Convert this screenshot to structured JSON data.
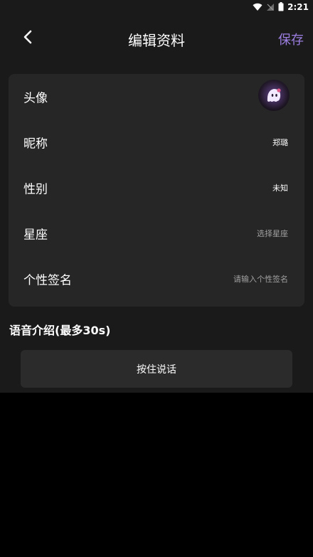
{
  "status_bar": {
    "time": "2:21"
  },
  "header": {
    "title": "编辑资料",
    "save_label": "保存",
    "accent_color": "#9b7ee0"
  },
  "profile": {
    "rows": [
      {
        "label": "头像",
        "type": "avatar",
        "icon": "ghost-avatar-icon"
      },
      {
        "label": "昵称",
        "value": "郑璐"
      },
      {
        "label": "性别",
        "value": "未知"
      },
      {
        "label": "星座",
        "placeholder": "选择星座"
      },
      {
        "label": "个性签名",
        "placeholder": "请输入个性签名"
      }
    ]
  },
  "voice": {
    "title": "语音介绍(最多30s)",
    "button_label": "按住说话"
  }
}
